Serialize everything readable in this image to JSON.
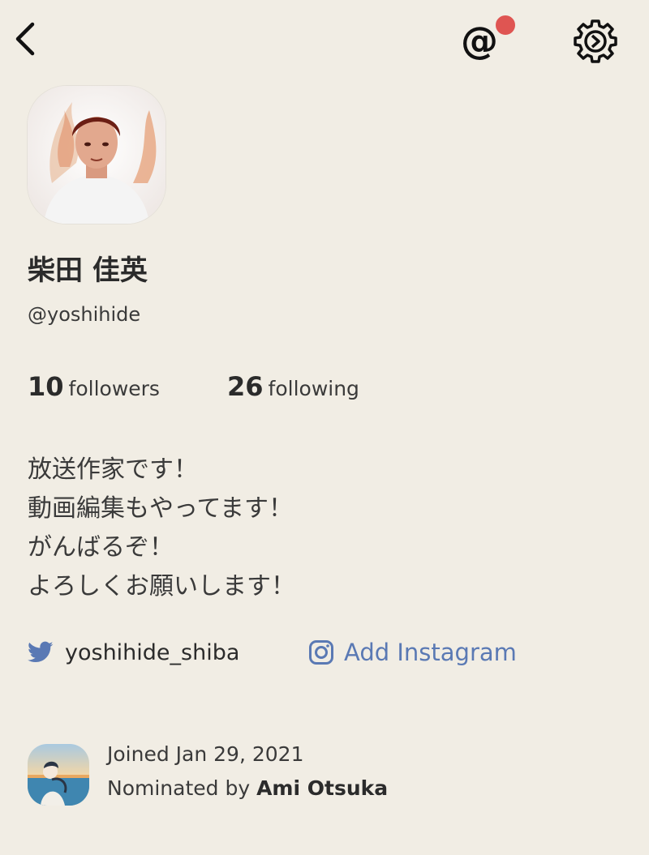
{
  "header": {
    "back_icon": "chevron-left-icon",
    "mention_icon": "at-sign-icon",
    "mention_glyph": "@",
    "notification_dot_color": "#df5552",
    "settings_icon": "gear-icon"
  },
  "profile": {
    "name": "柴田 佳英",
    "handle": "@yoshihide",
    "followers_count": "10",
    "followers_label": "followers",
    "following_count": "26",
    "following_label": "following",
    "bio_lines": [
      "放送作家です！",
      "動画編集もやってます！",
      "がんばるぞ！",
      "よろしくお願いします！"
    ]
  },
  "social": {
    "twitter_icon": "twitter-bird-icon",
    "twitter_handle": "yoshihide_shiba",
    "instagram_icon": "instagram-icon",
    "instagram_label": "Add Instagram",
    "link_color": "#5a79b4"
  },
  "footer": {
    "joined_text": "Joined Jan 29, 2021",
    "nominated_prefix": "Nominated by ",
    "nominator_name": "Ami Otsuka"
  },
  "colors": {
    "background": "#f1ede4",
    "text": "#2b2b2b"
  }
}
